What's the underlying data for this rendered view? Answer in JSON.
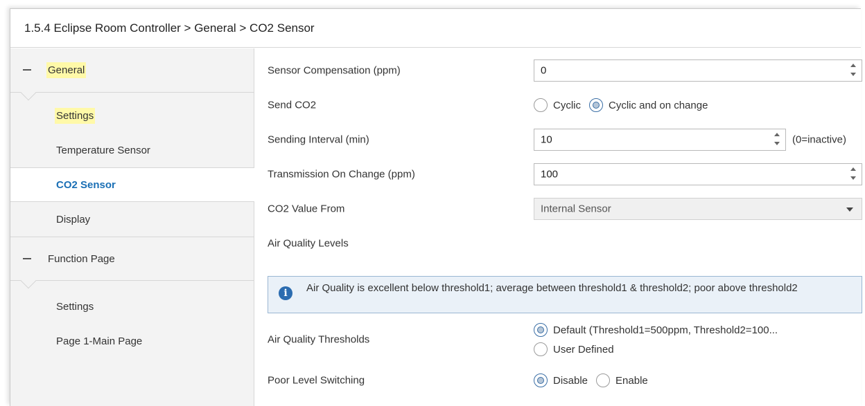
{
  "window": {
    "title": "1.5.4 Eclipse Room Controller > General > CO2 Sensor"
  },
  "sidebar": {
    "groups": [
      {
        "label": "General",
        "items": [
          {
            "label": "Settings",
            "highlighted": true
          },
          {
            "label": "Temperature Sensor"
          },
          {
            "label": "CO2 Sensor",
            "active": true
          },
          {
            "label": "Display"
          }
        ]
      },
      {
        "label": "Function Page",
        "items": [
          {
            "label": "Settings"
          },
          {
            "label": "Page 1-Main Page"
          }
        ]
      }
    ]
  },
  "params": {
    "sensor_comp": {
      "label": "Sensor Compensation (ppm)",
      "value": "0"
    },
    "send_co2": {
      "label": "Send CO2",
      "options": [
        "Cyclic",
        "Cyclic and on change"
      ],
      "selected": "Cyclic and on change"
    },
    "interval": {
      "label": "Sending Interval (min)",
      "value": "10",
      "suffix": "(0=inactive)"
    },
    "transmission": {
      "label": "Transmission On Change (ppm)",
      "value": "100"
    },
    "value_from": {
      "label": "CO2 Value From",
      "value": "Internal Sensor"
    },
    "air_quality_levels": {
      "label": "Air Quality Levels"
    },
    "info": {
      "text": "Air Quality is excellent below threshold1; average between threshold1 & threshold2; poor above threshold2"
    },
    "thresholds": {
      "label": "Air Quality Thresholds",
      "options": [
        "Default (Threshold1=500ppm, Threshold2=100...",
        "User Defined"
      ],
      "selected": "Default (Threshold1=500ppm, Threshold2=100..."
    },
    "poor_switching": {
      "label": "Poor Level Switching",
      "options": [
        "Disable",
        "Enable"
      ],
      "selected": "Disable"
    }
  },
  "colors": {
    "accent": "#1a6fb5",
    "highlight": "#fff9a8",
    "info_bg": "#eaf1f8"
  },
  "icons": {
    "info": "info-circle-icon",
    "spin": "spin-arrows-icon",
    "dropdown": "chevron-down-icon"
  }
}
